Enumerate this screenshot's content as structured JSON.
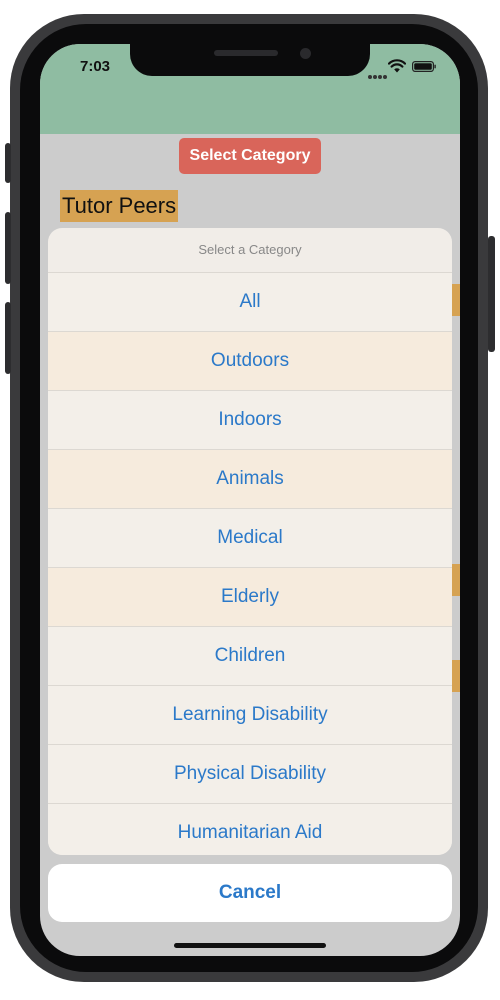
{
  "status_bar": {
    "time": "7:03"
  },
  "main": {
    "select_category_label": "Select Category",
    "selected_category": "Tutor Peers"
  },
  "action_sheet": {
    "title": "Select a Category",
    "options": [
      "All",
      "Outdoors",
      "Indoors",
      "Animals",
      "Medical",
      "Elderly",
      "Children",
      "Learning Disability",
      "Physical Disability",
      "Humanitarian Aid"
    ],
    "cancel_label": "Cancel"
  },
  "colors": {
    "header": "#8fbca2",
    "select_button": "#d9655a",
    "highlight": "#d6a252",
    "action_text": "#2b79c9"
  },
  "icons": {
    "wifi": "wifi-icon",
    "battery": "battery-icon"
  }
}
